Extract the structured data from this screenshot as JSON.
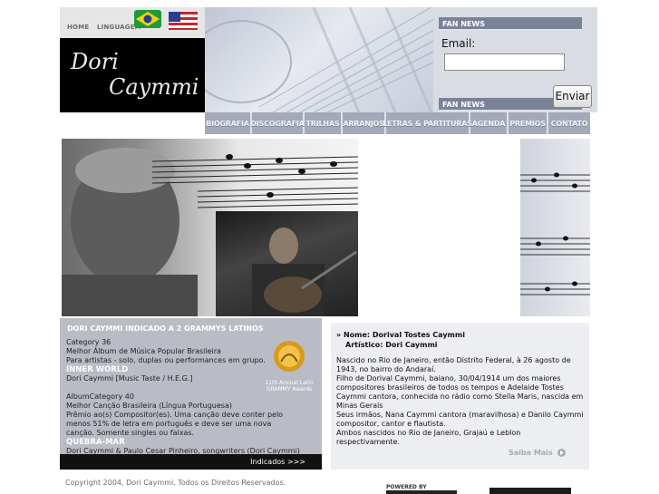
{
  "topbar": {
    "home": "HOME",
    "language": "LINGUAGEM"
  },
  "flags": [
    {
      "name": "brazil-flag-icon",
      "color": "#1b9b3a"
    },
    {
      "name": "usa-flag-icon",
      "color": "#c0282d"
    }
  ],
  "logo": {
    "line1": "Dori",
    "line2": "Caymmi"
  },
  "fan_news": {
    "title": "FAN NEWS",
    "title2": "FAN NEWS",
    "email_label": "Email:",
    "email_value": "",
    "submit": "Enviar"
  },
  "nav": [
    "BIOGRAFIA",
    "DISCOGRAFIA",
    "TRILHAS",
    "ARRANJOS",
    "LETRAS & PARTITURAS",
    "AGENDA",
    "PREMIOS",
    "CONTATO"
  ],
  "grammy": {
    "title": "DORI CAYMMI INDICADO A 2 GRAMMYS LATINOS",
    "cat1": "Category 36",
    "cat1_name": "Melhor Álbum de Música Popular Brasileira",
    "cat1_desc": "Para artistas - solo, duplas ou performances em grupo.",
    "work1": "INNER WORLD",
    "work1_credit": "Dori Caymmi [Music Taste / H.E.G.]",
    "cat2": "AlbumCategory 40",
    "cat2_name": "Melhor Canção Brasileira (Língua Portuguesa)",
    "cat2_desc": "Prêmio ao(s) Compositor(es). Uma canção deve conter pelo menos 51% de letra em português e deve ser uma nova canção. Somente singles ou faixas.",
    "work2": "QUEBRA-MAR",
    "work2_credit": "Dori Caymmi & Paulo Cesar Pinheiro, songwriters (Dori Caymmi) Trilha: Inner World [Music Taste]",
    "award_label": "11th Annual Latin GRAMMY Awards",
    "more": "Indicados >>>"
  },
  "bio": {
    "name_line": "» Nome: Dorival Tostes Caymmi",
    "artist_line": "Artístico: Dori Caymmi",
    "p1": "Nascido no Rio de Janeiro, então Distrito Federal, à 26 agosto de 1943, no bairro do Andaraí.",
    "p2": "Filho de Dorival Caymmi, baiano, 30/04/1914 um dos maiores compositores brasileiros de todos os tempos e Adelaide Tostes Caymmi cantora, conhecida no rádio como Stella Maris, nascida em Minas Gerais",
    "p3": "Seus irmãos, Nana Caymmi cantora (maravilhosa) e Danilo Caymmi compositor, cantor e flautista.",
    "p4": "Ambos nascidos no Rio de Janeiro, Grajaú e Leblon respectivamente.",
    "more": "Saiba Mais"
  },
  "footer": {
    "copyright": "Copyright 2004, Dori Caymmi. Todos os Direitos Reservados.",
    "powered": "POWERED BY"
  }
}
